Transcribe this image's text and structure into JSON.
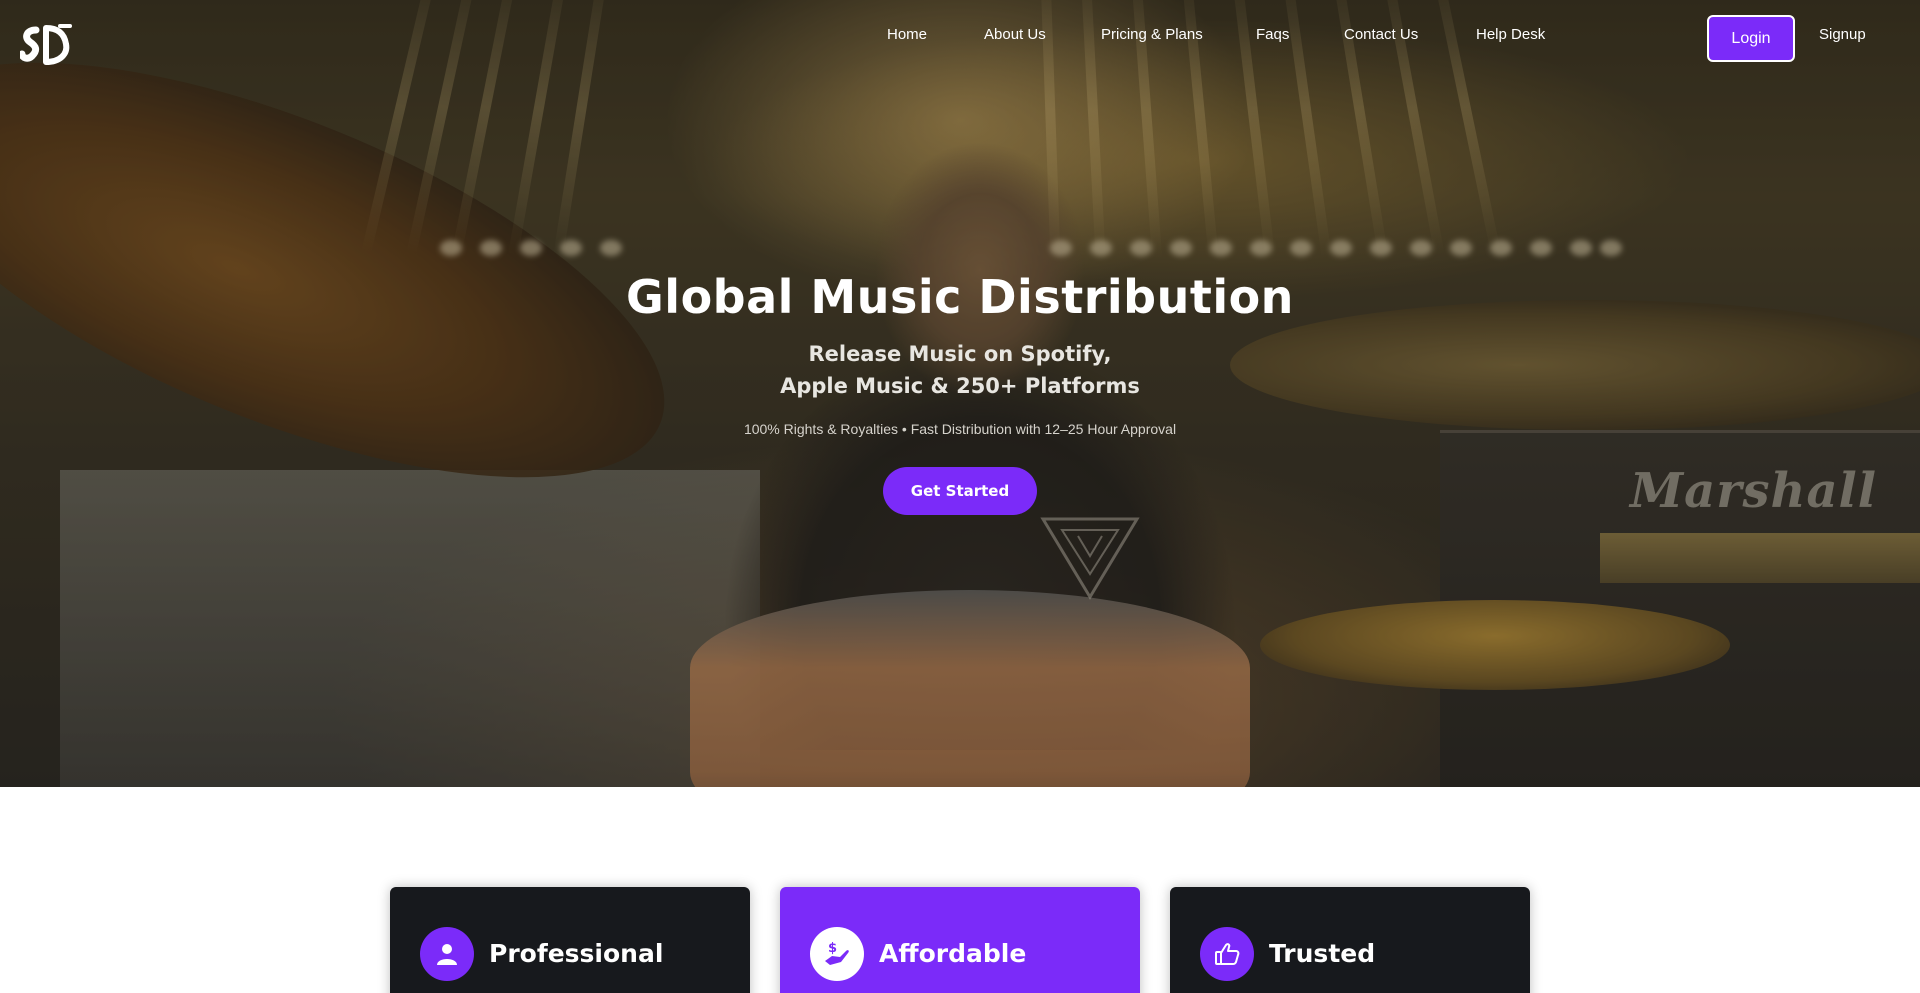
{
  "brand": {
    "logo_icon": "sd-music-logo-icon"
  },
  "nav": {
    "items": [
      {
        "label": "Home"
      },
      {
        "label": "About Us"
      },
      {
        "label": "Pricing & Plans"
      },
      {
        "label": "Faqs"
      },
      {
        "label": "Contact Us"
      },
      {
        "label": "Help Desk"
      }
    ],
    "login_label": "Login",
    "signup_label": "Signup"
  },
  "hero": {
    "title": "Global Music Distribution",
    "subtitle_line1": "Release Music on Spotify,",
    "subtitle_line2": "Apple Music & 250+ Platforms",
    "note": "100% Rights & Royalties • Fast Distribution with 12–25 Hour Approval",
    "cta_label": "Get Started"
  },
  "features": [
    {
      "title": "Professional",
      "icon": "user-icon",
      "style": "dark"
    },
    {
      "title": "Affordable",
      "icon": "money-hand-icon",
      "style": "purple"
    },
    {
      "title": "Trusted",
      "icon": "thumbs-up-icon",
      "style": "dark"
    }
  ],
  "colors": {
    "accent": "#7b2bf9",
    "card_dark": "#17191d",
    "text_light": "#ffffff"
  }
}
